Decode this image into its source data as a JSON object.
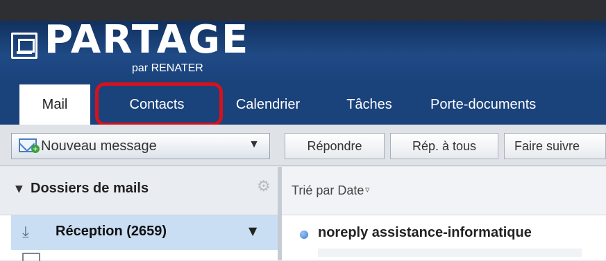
{
  "brand": {
    "name": "PARTAGE",
    "sub": "par RENATER"
  },
  "tabs": [
    {
      "label": "Mail",
      "active": true
    },
    {
      "label": "Contacts",
      "highlighted": true
    },
    {
      "label": "Calendrier"
    },
    {
      "label": "Tâches"
    },
    {
      "label": "Porte-documents"
    }
  ],
  "toolbar": {
    "new_message": "Nouveau message",
    "new_message_dropdown": "▼",
    "reply": "Répondre",
    "reply_all": "Rép. à tous",
    "forward": "Faire suivre"
  },
  "sidebar": {
    "header": "Dossiers de mails",
    "header_arrow": "▼",
    "gear": "⚙",
    "items": [
      {
        "label": "Réception (2659)",
        "icon": "inbox-icon",
        "dropdown": "▼",
        "selected": true
      }
    ]
  },
  "messages": {
    "sort_label": "Trié par Date",
    "sort_icon": "▿",
    "items": [
      {
        "sender": "noreply assistance-informatique",
        "unread": true
      }
    ]
  },
  "colors": {
    "header": "#1a427b",
    "highlight": "#d4121e",
    "selected": "#c9ddf3"
  }
}
